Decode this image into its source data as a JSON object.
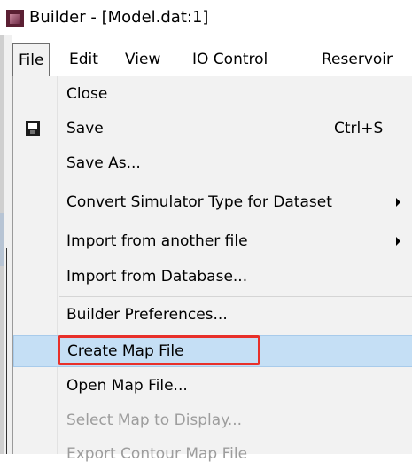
{
  "window": {
    "title": "Builder - [Model.dat:1]"
  },
  "menubar": {
    "items": [
      {
        "label": "File"
      },
      {
        "label": "Edit"
      },
      {
        "label": "View"
      },
      {
        "label": "IO Control"
      },
      {
        "label": "Reservoir"
      }
    ]
  },
  "file_menu": {
    "items": [
      {
        "label": "Close",
        "shortcut": "",
        "submenu": false,
        "enabled": true
      },
      {
        "label": "Save",
        "shortcut": "Ctrl+S",
        "icon": "save-icon",
        "submenu": false,
        "enabled": true
      },
      {
        "label": "Save As...",
        "shortcut": "",
        "submenu": false,
        "enabled": true
      },
      {
        "label": "Convert Simulator Type for Dataset",
        "shortcut": "",
        "submenu": true,
        "enabled": true
      },
      {
        "label": "Import from another file",
        "shortcut": "",
        "submenu": true,
        "enabled": true
      },
      {
        "label": "Import from Database...",
        "shortcut": "",
        "submenu": false,
        "enabled": true
      },
      {
        "label": "Builder Preferences...",
        "shortcut": "",
        "submenu": false,
        "enabled": true
      },
      {
        "label": "Create Map File",
        "shortcut": "",
        "submenu": false,
        "enabled": true,
        "highlighted": true
      },
      {
        "label": "Open Map File...",
        "shortcut": "",
        "submenu": false,
        "enabled": true
      },
      {
        "label": "Select Map to Display...",
        "shortcut": "",
        "submenu": false,
        "enabled": false
      },
      {
        "label": "Export Contour Map File",
        "shortcut": "",
        "submenu": false,
        "enabled": false
      }
    ]
  },
  "colors": {
    "menu_background": "#f2f2f2",
    "highlight": "#c5dff5",
    "annotation": "#e8302a",
    "disabled_text": "#9d9d9d"
  }
}
